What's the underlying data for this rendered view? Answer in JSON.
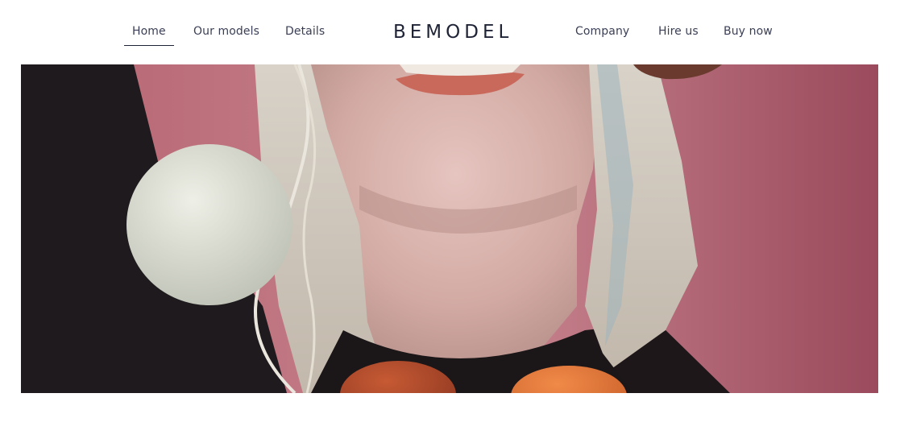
{
  "nav": {
    "left": [
      {
        "label": "Home",
        "active": true
      },
      {
        "label": "Our models",
        "active": false
      },
      {
        "label": "Details",
        "active": false
      }
    ],
    "brand": "BEMODEL",
    "right": [
      {
        "label": "Company"
      },
      {
        "label": "Hire us"
      },
      {
        "label": "Buy now"
      }
    ]
  },
  "hero": {
    "image": "portrait-photo"
  },
  "colors": {
    "text": "#3a3f55",
    "brand": "#1f2336",
    "background": "#ffffff",
    "hero_backdrop": "#c27882"
  }
}
